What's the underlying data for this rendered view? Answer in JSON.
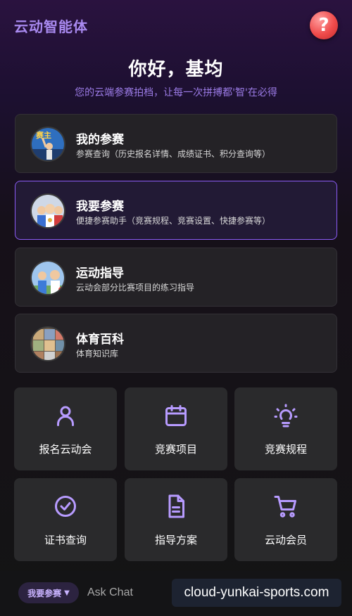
{
  "header": {
    "brand": "云动智能体",
    "help_icon": "question-mark-icon",
    "help_glyph": "?"
  },
  "hero": {
    "greeting": "你好，基均",
    "subtitle": "您的云端参赛拍档，让每一次拼搏都'智'在必得"
  },
  "cards": [
    {
      "title": "我的参赛",
      "desc": "参赛查询（历史报名详情、成绩证书、积分查询等）",
      "active": false
    },
    {
      "title": "我要参赛",
      "desc": "便捷参赛助手（竞赛规程、竞赛设置、快捷参赛等）",
      "active": true
    },
    {
      "title": "运动指导",
      "desc": "云动会部分比赛项目的练习指导",
      "active": false
    },
    {
      "title": "体育百科",
      "desc": "体育知识库",
      "active": false
    }
  ],
  "card_avatar_text": "赛主",
  "tiles": [
    {
      "label": "报名云动会",
      "icon": "user-icon"
    },
    {
      "label": "竞赛项目",
      "icon": "calendar-icon"
    },
    {
      "label": "竞赛规程",
      "icon": "lightbulb-icon"
    },
    {
      "label": "证书查询",
      "icon": "check-circle-icon"
    },
    {
      "label": "指导方案",
      "icon": "document-icon"
    },
    {
      "label": "云动会员",
      "icon": "cart-icon"
    }
  ],
  "bottom": {
    "mode_label": "我要参赛",
    "mode_arrow": "▼",
    "placeholder": "Ask Chat"
  },
  "watermark": "cloud-yunkai-sports.com",
  "colors": {
    "accent": "#8b5cf6",
    "brand": "#a98af0",
    "icon": "#b79bff",
    "help": "#ef4b4b"
  }
}
